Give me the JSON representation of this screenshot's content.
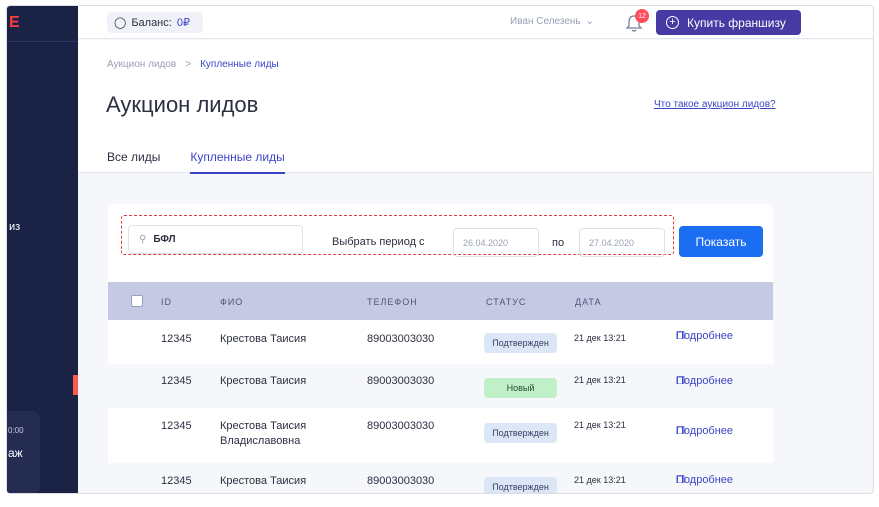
{
  "sidebar": {
    "logo": "E",
    "item_text": "из",
    "card_time": "0:00",
    "card_text": "аж"
  },
  "header": {
    "balance_label": "Баланс:",
    "balance_amount": "0₽",
    "user_name": "Иван Селезень",
    "notifications_count": "12",
    "buy_button": "Купить франшизу"
  },
  "breadcrumb": {
    "items": [
      "Аукцион лидов",
      "Купленные лиды"
    ],
    "separator": ">"
  },
  "page": {
    "title": "Аукцион лидов",
    "help_link": "Что такое аукцион лидов?",
    "tabs": [
      {
        "label": "Все лиды"
      },
      {
        "label": "Купленные лиды",
        "active": true
      }
    ]
  },
  "filters": {
    "search_value": "БФЛ",
    "period_label": "Выбрать период  с",
    "date_from": "26.04.2020",
    "to_label": "по",
    "date_to": "27.04.2020",
    "show_button": "Показать"
  },
  "table": {
    "columns": [
      "ID",
      "ФИО",
      "ТЕЛЕФОН",
      "СТАТУС",
      "ДАТА"
    ],
    "rows": [
      {
        "id": "12345",
        "name": "Крестова Таисия",
        "name2": "",
        "phone": "89003003030",
        "status": "Подтвержден",
        "date": "21 дек 13:21",
        "action": "Подробнее"
      },
      {
        "id": "12345",
        "name": "Крестова Таисия",
        "name2": "",
        "phone": "89003003030",
        "status": "Новый",
        "date": "21 дек 13:21",
        "action": "Подробнее"
      },
      {
        "id": "12345",
        "name": "Крестова Таисия",
        "name2": "Владиславовна",
        "phone": "89003003030",
        "status": "Подтвержден",
        "date": "21 дек 13:21",
        "action": "Подробнее"
      },
      {
        "id": "12345",
        "name": "Крестова Таисия",
        "name2": "",
        "phone": "89003003030",
        "status": "Подтвержден",
        "date": "21 дек 13:21",
        "action": "Подробнее"
      }
    ]
  },
  "colors": {
    "accent": "#3a46c7",
    "primary_button": "#1b6ef2",
    "brand_button": "#463aa3",
    "sidebar": "#1a2245",
    "confirmed": "#dbe6f7",
    "new": "#bff0c8"
  }
}
